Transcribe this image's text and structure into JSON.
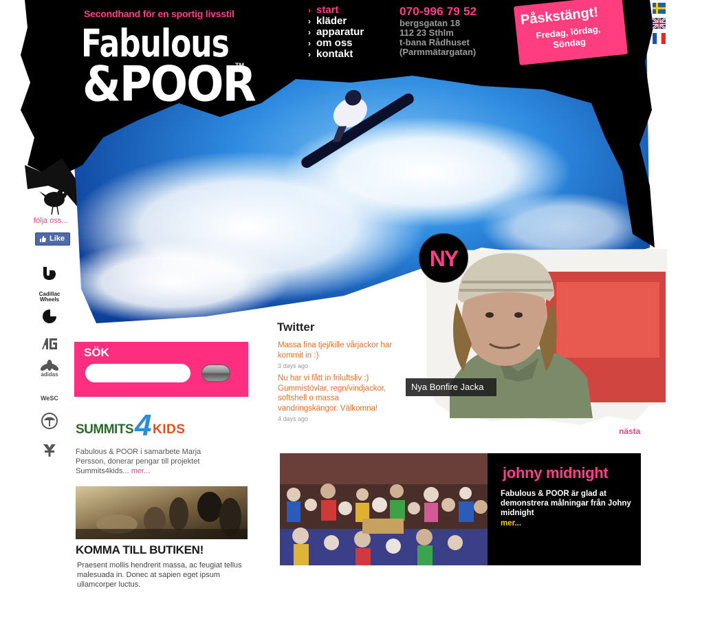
{
  "header": {
    "tagline": "Secondhand för en sportig livsstil",
    "logo_line1": "Fabulous",
    "logo_line2": "&POOR",
    "logo_tm": "TM"
  },
  "nav": {
    "items": [
      {
        "label": "start",
        "active": true
      },
      {
        "label": "kläder",
        "active": false
      },
      {
        "label": "apparatur",
        "active": false
      },
      {
        "label": "om oss",
        "active": false
      },
      {
        "label": "kontakt",
        "active": false
      }
    ]
  },
  "contact": {
    "phone": "070-996 79 52",
    "address": [
      "bergsgatan 18",
      "112 23 Sthlm",
      "t-bana Rådhuset",
      "(Parmmätargatan)"
    ]
  },
  "easter": {
    "title": "Påskstängt!",
    "line1": "Fredag, lördag,",
    "line2": "Söndag"
  },
  "languages": [
    "sv",
    "en",
    "fr"
  ],
  "social": {
    "follow": "följa oss...",
    "like": "Like"
  },
  "brands": [
    "burton-icon",
    "cadillac-wheels-icon",
    "carhartt-icon",
    "analog-icon",
    "adidas-icon",
    "wesc-icon",
    "arbor-icon",
    "volcom-icon"
  ],
  "brand_texts": {
    "cadillac": "Cadillac Wheels",
    "adidas": "adidas",
    "wesc": "WeSC"
  },
  "search": {
    "label": "SÖK",
    "placeholder": ""
  },
  "summits": {
    "logo_a": "SUMMITS",
    "logo_4": "4",
    "logo_b": "KIDS",
    "text": "Fabulous & POOR i samarbete Marja Persson, donerar pengar till projektet Summits4kids...",
    "more": "mer..."
  },
  "shop": {
    "title": "KOMMA TILL BUTIKEN!",
    "text": "Praesent mollis hendrerit massa, ac feugiat tellus malesuada in. Donec at sapien eget ipsum ullamcorper luctus."
  },
  "twitter": {
    "title": "Twitter",
    "tweets": [
      {
        "text": "Massa fina tjej/kille vårjackor har kommit in :)",
        "time": "3 days ago"
      },
      {
        "text": "Nu har vi fått in friluftsliv :) Gummistövlar, regn/vindjackor, softshell o massa vandringskängor. Välkomna!",
        "time": "4 days ago"
      }
    ]
  },
  "feature": {
    "badge": "NY",
    "caption": "Nya Bonfire Jacka",
    "next": "nästa"
  },
  "johny": {
    "title": "johny midnight",
    "text": "Fabulous & POOR är glad at demonstrera målningar från Johny midnight",
    "more": "mer..."
  },
  "colors": {
    "accent_pink": "#ff3d8a",
    "tweet_orange": "#ff6a1a",
    "johny_more_yellow": "#ffcc00",
    "hero_black": "#000000",
    "sky_blue": "#1f7fd8"
  }
}
